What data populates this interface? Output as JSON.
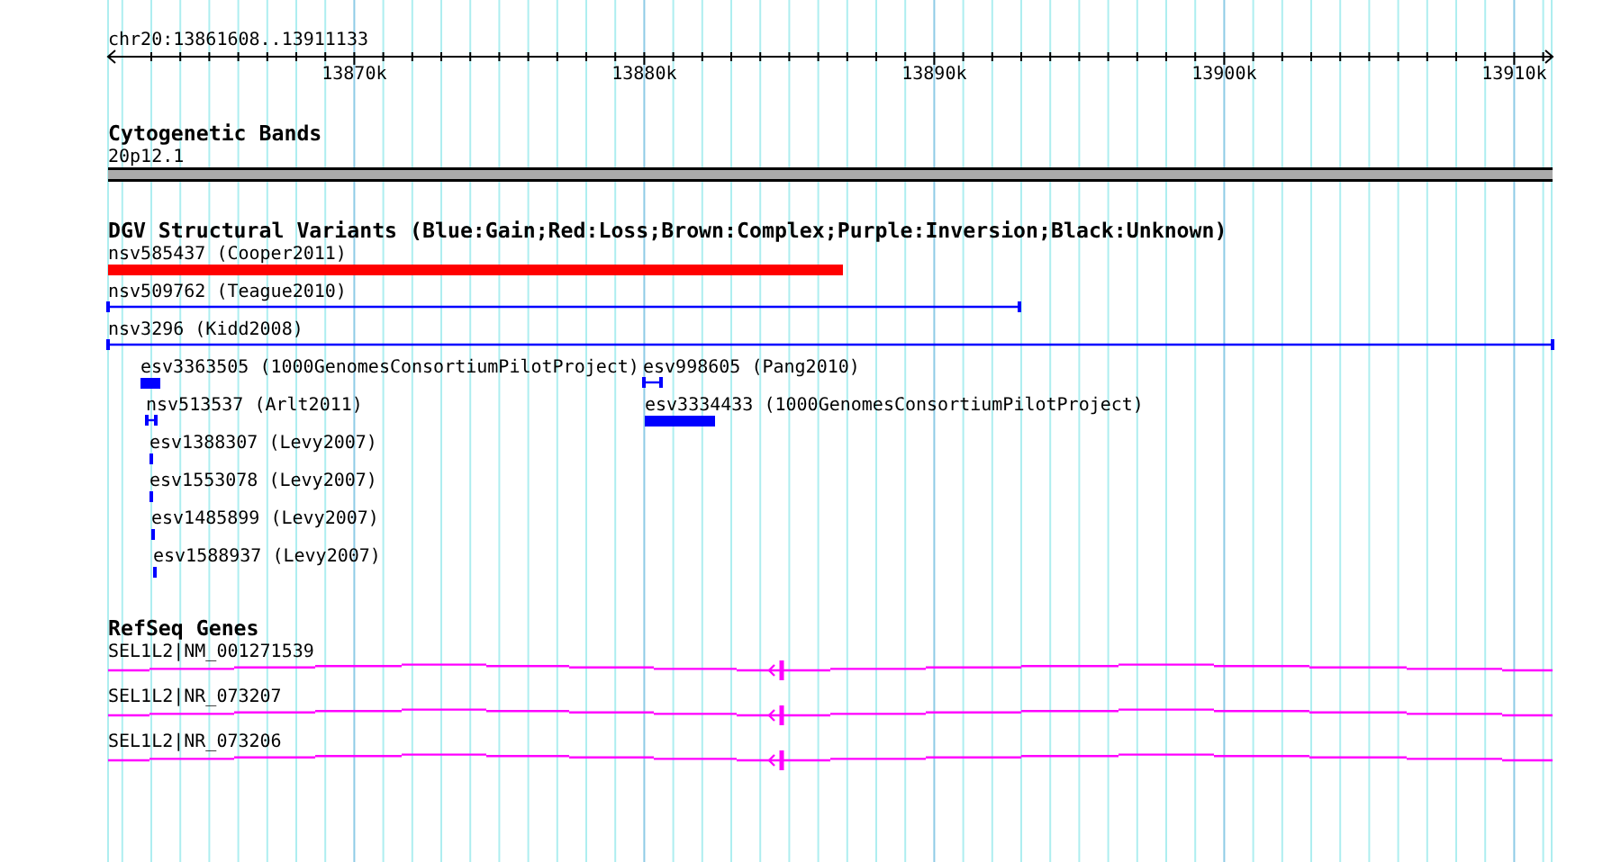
{
  "ruler": {
    "locus": "chr20:13861608..13911133",
    "tick_labels": [
      "13870k",
      "13880k",
      "13890k",
      "13900k",
      "13910k"
    ]
  },
  "tracks": [
    {
      "kind": "cytoband",
      "title": "Cytogenetic Bands",
      "features": [
        {
          "label": "20p12.1",
          "kind": "band"
        }
      ]
    },
    {
      "kind": "variants",
      "title": "DGV Structural Variants (Blue:Gain;Red:Loss;Brown:Complex;Purple:Inversion;Black:Unknown)",
      "features": [
        {
          "label": "nsv585437 (Cooper2011)",
          "kind": "box",
          "color": "#ff0000"
        },
        {
          "label": "nsv509762 (Teague2010)",
          "kind": "span",
          "color": "#0000ff"
        },
        {
          "label": "nsv3296 (Kidd2008)",
          "kind": "span",
          "color": "#0000ff"
        },
        {
          "label": "esv3363505 (1000GenomesConsortiumPilotProject)",
          "kind": "box",
          "color": "#0000ff"
        },
        {
          "label": "esv998605 (Pang2010)",
          "kind": "span",
          "color": "#0000ff"
        },
        {
          "label": "nsv513537 (Arlt2011)",
          "kind": "span",
          "color": "#0000ff"
        },
        {
          "label": "esv3334433 (1000GenomesConsortiumPilotProject)",
          "kind": "box",
          "color": "#0000ff"
        },
        {
          "label": "esv1388307 (Levy2007)",
          "kind": "box",
          "color": "#0000ff"
        },
        {
          "label": "esv1553078 (Levy2007)",
          "kind": "box",
          "color": "#0000ff"
        },
        {
          "label": "esv1485899 (Levy2007)",
          "kind": "box",
          "color": "#0000ff"
        },
        {
          "label": "esv1588937 (Levy2007)",
          "kind": "box",
          "color": "#0000ff"
        }
      ]
    },
    {
      "kind": "genes",
      "title": "RefSeq Genes",
      "features": [
        {
          "label": "SEL1L2|NM_001271539",
          "kind": "gene"
        },
        {
          "label": "SEL1L2|NR_073207",
          "kind": "gene"
        },
        {
          "label": "SEL1L2|NR_073206",
          "kind": "gene"
        }
      ]
    }
  ]
}
